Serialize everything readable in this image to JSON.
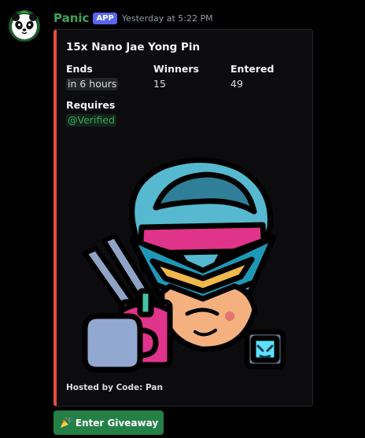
{
  "message": {
    "author": "Panic",
    "badge": "APP",
    "timestamp": "Yesterday at 5:22 PM"
  },
  "embed": {
    "accent_color": "#e74c3c",
    "title": "15x Nano Jae Yong Pin",
    "fields": [
      {
        "name": "Ends",
        "value": "in 6 hours"
      },
      {
        "name": "Winners",
        "value": "15"
      },
      {
        "name": "Entered",
        "value": "49"
      }
    ],
    "requires": {
      "name": "Requires",
      "value": "@Verified"
    },
    "image_icon": "nano-jae-yong-pin-image",
    "footer": "Hosted by Code: Pan"
  },
  "button": {
    "label": "Enter Giveaway",
    "icon": "party-popper-icon",
    "color": "#248046"
  }
}
